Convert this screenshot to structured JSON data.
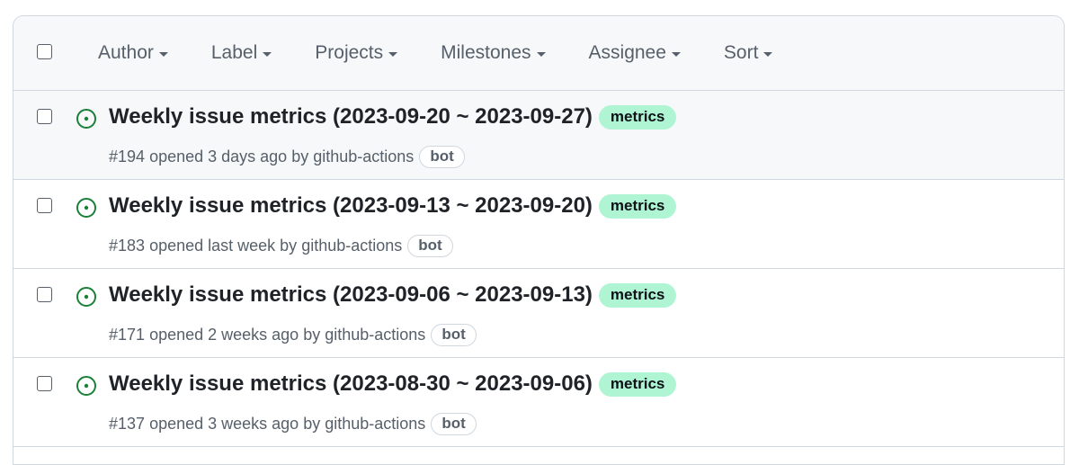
{
  "filters": [
    {
      "label": "Author"
    },
    {
      "label": "Label"
    },
    {
      "label": "Projects"
    },
    {
      "label": "Milestones"
    },
    {
      "label": "Assignee"
    },
    {
      "label": "Sort"
    }
  ],
  "issues": [
    {
      "title": "Weekly issue metrics (2023-09-20 ~ 2023-09-27)",
      "label": "metrics",
      "number": "#194",
      "opened": "opened 3 days ago by",
      "author": "github-actions",
      "badge": "bot"
    },
    {
      "title": "Weekly issue metrics (2023-09-13 ~ 2023-09-20)",
      "label": "metrics",
      "number": "#183",
      "opened": "opened last week by",
      "author": "github-actions",
      "badge": "bot"
    },
    {
      "title": "Weekly issue metrics (2023-09-06 ~ 2023-09-13)",
      "label": "metrics",
      "number": "#171",
      "opened": "opened 2 weeks ago by",
      "author": "github-actions",
      "badge": "bot"
    },
    {
      "title": "Weekly issue metrics (2023-08-30 ~ 2023-09-06)",
      "label": "metrics",
      "number": "#137",
      "opened": "opened 3 weeks ago by",
      "author": "github-actions",
      "badge": "bot"
    }
  ],
  "icons": {
    "issue_open": "issue-opened-icon",
    "dropdown": "caret-down-icon"
  },
  "colors": {
    "open_icon": "#1a7f37",
    "label_metrics_bg": "#aff5d4",
    "header_bg": "#f6f8fa",
    "hover_row_bg": "#f6f8fa",
    "border": "#d0d7de",
    "muted_text": "#57606a"
  }
}
